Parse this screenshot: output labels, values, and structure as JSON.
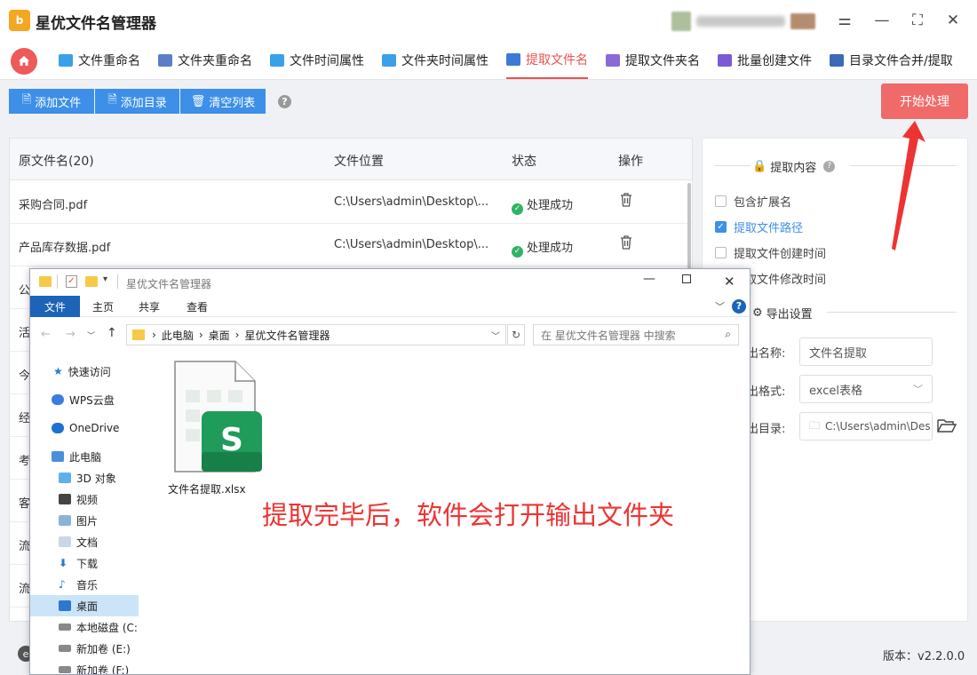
{
  "app": {
    "logo_text": "b",
    "title": "星优文件名管理器"
  },
  "window_controls": {
    "settings_glyph": "⚌",
    "minimize_glyph": "—",
    "maximize_glyph": "⛶",
    "close_glyph": "✕"
  },
  "nav": {
    "tabs": [
      {
        "label": "文件重命名",
        "icon": "rename-file-icon",
        "color": "#3aa0e8"
      },
      {
        "label": "文件夹重命名",
        "icon": "rename-folder-icon",
        "color": "#5a7fc8"
      },
      {
        "label": "文件时间属性",
        "icon": "file-time-icon",
        "color": "#3aa0e8"
      },
      {
        "label": "文件夹时间属性",
        "icon": "folder-time-icon",
        "color": "#3aa0e8"
      },
      {
        "label": "提取文件名",
        "icon": "extract-filename-icon",
        "color": "#3b7bd6"
      },
      {
        "label": "提取文件夹名",
        "icon": "extract-foldername-icon",
        "color": "#8a6ad6"
      },
      {
        "label": "批量创建文件",
        "icon": "batch-create-icon",
        "color": "#7a5ad6"
      },
      {
        "label": "目录文件合并/提取",
        "icon": "merge-extract-icon",
        "color": "#3a6ab8"
      }
    ],
    "active_index": 4,
    "accent": "#e85252"
  },
  "toolbar": {
    "add_file": "添加文件",
    "add_dir": "添加目录",
    "clear_list": "清空列表",
    "help": "?",
    "start": "开始处理"
  },
  "table": {
    "headers": [
      "原文件名(20)",
      "文件位置",
      "状态",
      "操作"
    ],
    "rows": [
      {
        "name": "采购合同.pdf",
        "location": "C:\\Users\\admin\\Desktop\\...",
        "status": "处理成功"
      },
      {
        "name": "产品库存数据.pdf",
        "location": "C:\\Users\\admin\\Desktop\\...",
        "status": "处理成功"
      }
    ],
    "hidden_rows_first_chars": [
      "公",
      "活",
      "今",
      "经",
      "考",
      "客",
      "流",
      "流"
    ],
    "status_color": "#2fb463"
  },
  "settings": {
    "extract_title": "提取内容",
    "options": [
      {
        "label": "包含扩展名",
        "checked": false
      },
      {
        "label": "提取文件路径",
        "checked": true
      },
      {
        "label": "提取文件创建时间",
        "checked": false
      },
      {
        "label": "提取文件修改时间",
        "checked": false
      }
    ],
    "export_title": "导出设置",
    "export_name_label": "出名称:",
    "export_name_value": "文件名提取",
    "export_format_label": "出格式:",
    "export_format_value": "excel表格",
    "export_dir_label": "出目录:",
    "export_dir_value": "C:\\Users\\admin\\Des"
  },
  "footer": {
    "version": "版本：v2.2.0.0"
  },
  "explorer": {
    "title": "星优文件名管理器",
    "ribbon_tabs": [
      "文件",
      "主页",
      "共享",
      "查看"
    ],
    "breadcrumb": [
      "此电脑",
      "桌面",
      "星优文件名管理器"
    ],
    "search_placeholder": "在 星优文件名管理器 中搜索",
    "sidebar": [
      {
        "label": "快速访问",
        "icon": "star-icon"
      },
      {
        "label": "WPS云盘",
        "icon": "cloud-icon"
      },
      {
        "label": "OneDrive",
        "icon": "onedrive-icon"
      },
      {
        "label": "此电脑",
        "icon": "computer-icon"
      },
      {
        "label": "3D 对象",
        "icon": "cube-icon"
      },
      {
        "label": "视频",
        "icon": "video-icon"
      },
      {
        "label": "图片",
        "icon": "picture-icon"
      },
      {
        "label": "文档",
        "icon": "document-icon"
      },
      {
        "label": "下载",
        "icon": "download-icon"
      },
      {
        "label": "音乐",
        "icon": "music-icon"
      },
      {
        "label": "桌面",
        "icon": "desktop-icon",
        "selected": true
      },
      {
        "label": "本地磁盘 (C:",
        "icon": "disk-icon"
      },
      {
        "label": "新加卷 (E:)",
        "icon": "disk-icon"
      },
      {
        "label": "新加卷 (F:)",
        "icon": "disk-icon"
      }
    ],
    "file_name": "文件名提取.xlsx",
    "file_badge": "S"
  },
  "annotation": {
    "text": "提取完毕后，软件会打开输出文件夹",
    "color": "#ee3333"
  }
}
